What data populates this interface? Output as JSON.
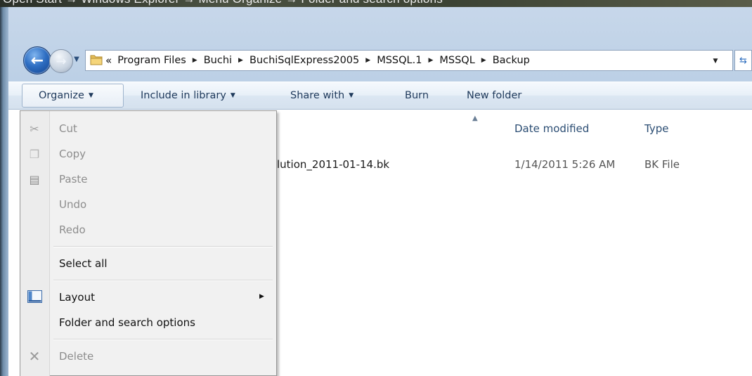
{
  "caption": "Open Start → Windows Explorer → Menu Organize → Folder and search options",
  "nav": {
    "back_icon": "back-arrow-icon",
    "forward_icon": "forward-arrow-icon",
    "overflow_chevron": "«",
    "breadcrumb": [
      "Program Files",
      "Buchi",
      "BuchiSqlExpress2005",
      "MSSQL.1",
      "MSSQL",
      "Backup"
    ]
  },
  "toolbar": {
    "organize": "Organize",
    "include_in_library": "Include in library",
    "share_with": "Share with",
    "burn": "Burn",
    "new_folder": "New folder"
  },
  "columns": {
    "date_modified": "Date modified",
    "type": "Type"
  },
  "files": [
    {
      "name": "lution_2011-01-14.bk",
      "date_modified": "1/14/2011 5:26 AM",
      "type": "BK File"
    }
  ],
  "organize_menu": {
    "cut": "Cut",
    "copy": "Copy",
    "paste": "Paste",
    "undo": "Undo",
    "redo": "Redo",
    "select_all": "Select all",
    "layout": "Layout",
    "folder_and_search_options": "Folder and search options",
    "delete": "Delete"
  },
  "colors": {
    "window_frame": "#bcd0e6",
    "toolbar_text": "#1e395b",
    "header_text": "#2b4d73",
    "menu_bg": "#f1f1f1",
    "disabled_text": "#8d8d8d"
  }
}
